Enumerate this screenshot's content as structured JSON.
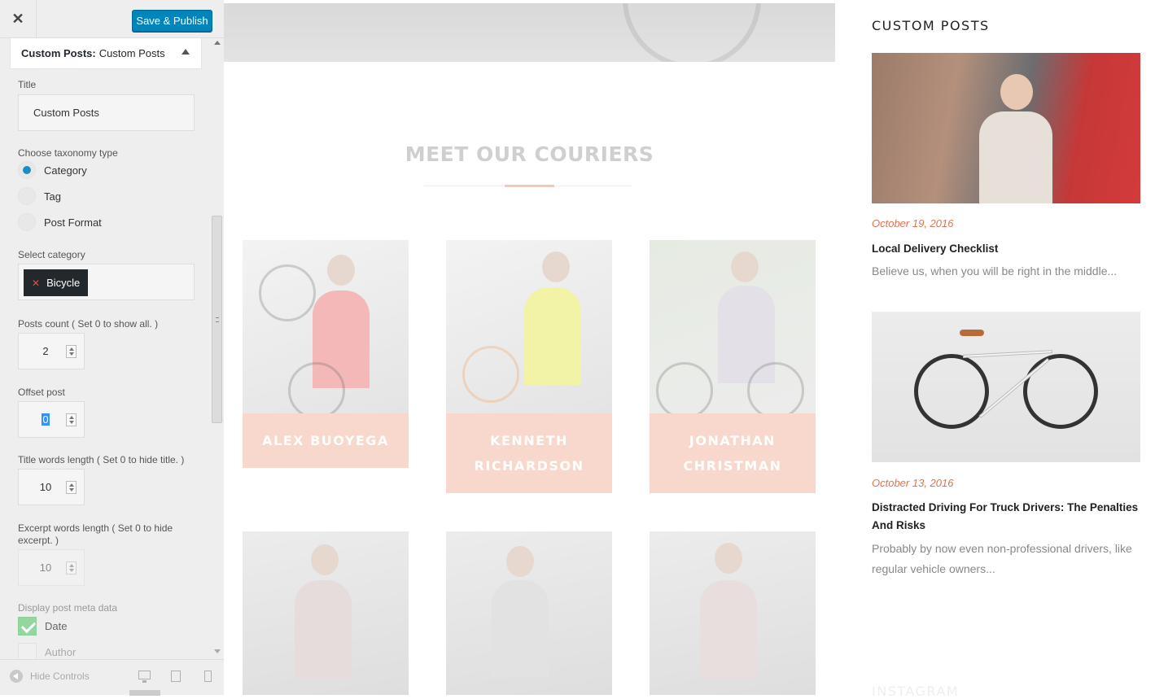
{
  "customizer": {
    "close_icon": "close-icon",
    "publish_label": "Save & Publish",
    "widget": {
      "title_bold": "Custom Posts:",
      "title_rest": "Custom Posts"
    },
    "fields": {
      "title_label": "Title",
      "title_value": "Custom Posts",
      "taxonomy_label": "Choose taxonomy type",
      "taxonomy_options": [
        "Category",
        "Tag",
        "Post Format"
      ],
      "taxonomy_selected": "Category",
      "category_label": "Select category",
      "category_chip": "Bicycle",
      "posts_count_label": "Posts count ( Set 0 to show all. )",
      "posts_count_value": "2",
      "offset_label": "Offset post",
      "offset_value": "0",
      "title_words_label": "Title words length ( Set 0 to hide title. )",
      "title_words_value": "10",
      "excerpt_words_label": "Excerpt words length ( Set 0 to hide excerpt. )",
      "excerpt_words_value": "10",
      "meta_label": "Display post meta data",
      "meta_options": [
        "Date",
        "Author"
      ],
      "meta_checked": [
        "Date"
      ]
    },
    "footer": {
      "hide_controls": "Hide Controls"
    }
  },
  "preview": {
    "section_title": "MEET OUR COURIERS",
    "couriers": [
      "ALEX BUOYEGA",
      "KENNETH RICHARDSON",
      "JONATHAN CHRISTMAN"
    ]
  },
  "sidebar_widget": {
    "title": "CUSTOM POSTS",
    "posts": [
      {
        "date": "October 19, 2016",
        "title": "Local Delivery Checklist",
        "excerpt": "Believe us, when you will be right in the middle..."
      },
      {
        "date": "October 13, 2016",
        "title": "Distracted Driving For Truck Drivers: The Penalties And Risks",
        "excerpt": "Probably by now even non-professional drivers, like regular vehicle owners..."
      }
    ],
    "next_widget": "INSTAGRAM"
  },
  "colors": {
    "accent": "#0085ba",
    "date": "#e07350",
    "name_plate": "#f8d8cc"
  }
}
